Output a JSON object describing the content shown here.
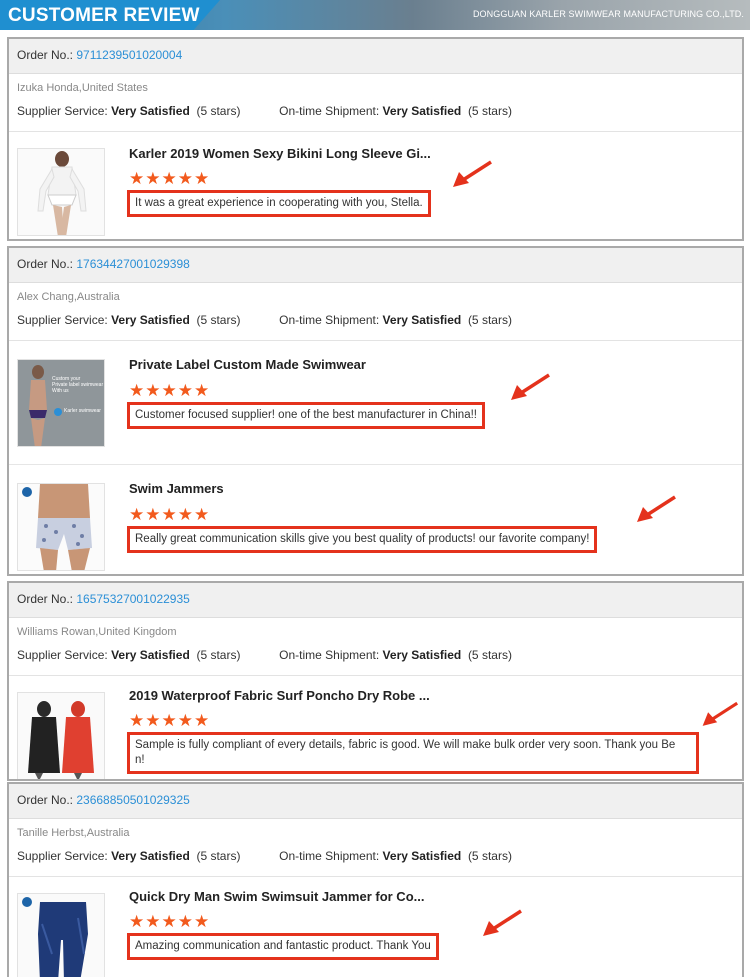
{
  "header": {
    "title": "CUSTOMER REVIEW",
    "company": "DONGGUAN KARLER SWIMWEAR MANUFACTURING CO.,LTD."
  },
  "labels": {
    "order_no": "Order No.:",
    "supplier_service": "Supplier Service:",
    "ontime_shipment": "On-time Shipment:"
  },
  "colors": {
    "accent": "#1f8fd0",
    "highlight": "#e4321c",
    "star": "#f25a1d",
    "link": "#2b8fd6"
  },
  "reviews": [
    {
      "order_no": "9711239501020004",
      "customer": "Izuka Honda,United States",
      "supplier_rating": "Very Satisfied",
      "supplier_stars": "(5 stars)",
      "shipment_rating": "Very Satisfied",
      "shipment_stars": "(5 stars)",
      "products": [
        {
          "title": "Karler 2019 Women Sexy Bikini Long Sleeve Gi...",
          "stars": "★★★★★",
          "rating": 5,
          "comment": "It was a great experience in cooperating with you, Stella.",
          "thumb_icon": "bikini-model-image"
        }
      ]
    },
    {
      "order_no": "17634427001029398",
      "customer": "Alex Chang,Australia",
      "supplier_rating": "Very Satisfied",
      "supplier_stars": "(5 stars)",
      "shipment_rating": "Very Satisfied",
      "shipment_stars": "(5 stars)",
      "products": [
        {
          "title": "Private Label Custom Made Swimwear",
          "stars": "★★★★★",
          "rating": 5,
          "comment": "Customer focused supplier! one of the best manufacturer in China!!",
          "thumb_icon": "swim-brief-model-image",
          "thumb_text": [
            "Custom your",
            "Private label swimwear",
            "With us",
            "Karler swimwear"
          ]
        },
        {
          "title": "Swim Jammers",
          "stars": "★★★★★",
          "rating": 5,
          "comment": "Really great communication skills give you best quality of products! our favorite company!",
          "thumb_icon": "jammer-model-image"
        }
      ]
    },
    {
      "order_no": "16575327001022935",
      "customer": "Williams Rowan,United Kingdom",
      "supplier_rating": "Very Satisfied",
      "supplier_stars": "(5 stars)",
      "shipment_rating": "Very Satisfied",
      "shipment_stars": "(5 stars)",
      "products": [
        {
          "title": "2019 Waterproof Fabric Surf Poncho Dry Robe ...",
          "stars": "★★★★★",
          "rating": 5,
          "comment_line1": "Sample is fully compliant of every details, fabric is good. We will make bulk order very soon. Thank you Be",
          "comment_line2": "n!",
          "thumb_icon": "dry-robe-image"
        }
      ]
    },
    {
      "order_no": "23668850501029325",
      "customer": "Tanille Herbst,Australia",
      "supplier_rating": "Very Satisfied",
      "supplier_stars": "(5 stars)",
      "shipment_rating": "Very Satisfied",
      "shipment_stars": "(5 stars)",
      "products": [
        {
          "title": "Quick Dry Man Swim Swimsuit Jammer for Co...",
          "stars": "★★★★★",
          "rating": 5,
          "comment": "Amazing communication and fantastic product. Thank You",
          "thumb_icon": "navy-jammer-image"
        }
      ]
    }
  ]
}
